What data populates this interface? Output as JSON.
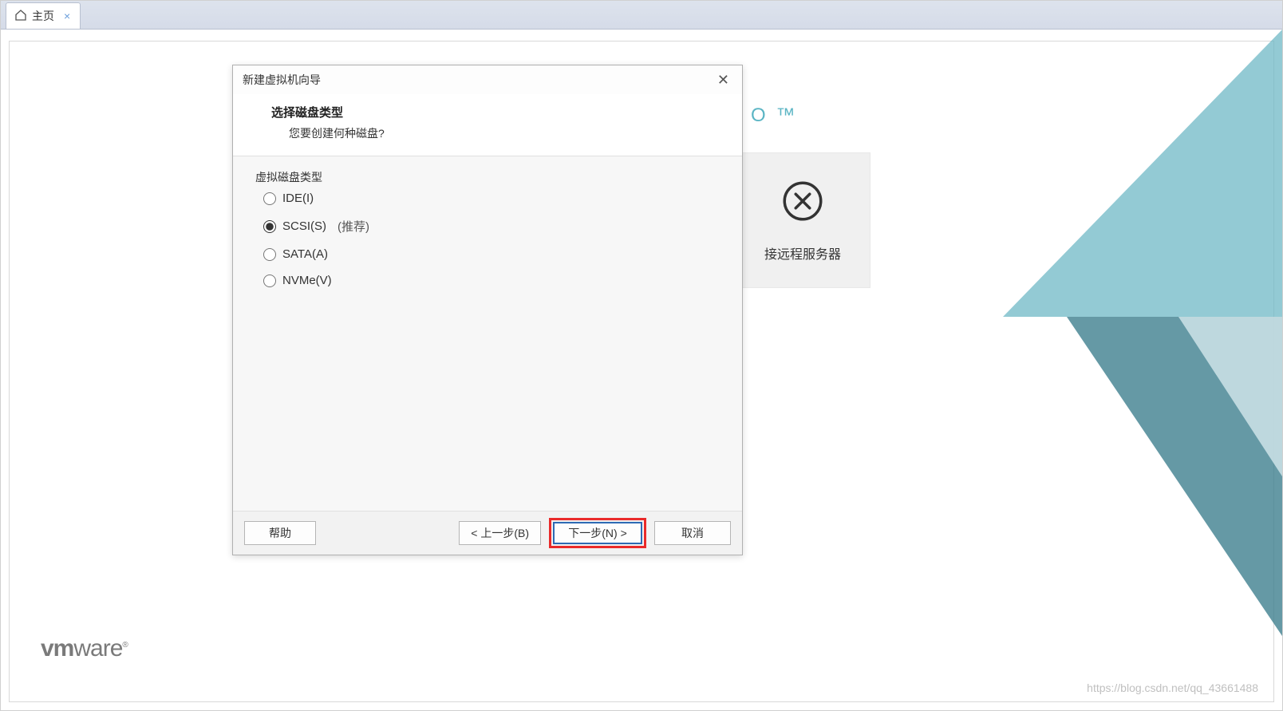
{
  "tab": {
    "label": "主页"
  },
  "background": {
    "tile_label": "接远程服务器",
    "trademark_suffix": "O ™",
    "vmware_logo_prefix": "vm",
    "vmware_logo_suffix": "ware",
    "vmware_logo_reg": "®"
  },
  "dialog": {
    "title": "新建虚拟机向导",
    "heading": "选择磁盘类型",
    "subheading": "您要创建何种磁盘?",
    "group_label": "虚拟磁盘类型",
    "options": [
      {
        "label": "IDE(I)",
        "selected": false,
        "hint": ""
      },
      {
        "label": "SCSI(S)",
        "selected": true,
        "hint": "(推荐)"
      },
      {
        "label": "SATA(A)",
        "selected": false,
        "hint": ""
      },
      {
        "label": "NVMe(V)",
        "selected": false,
        "hint": ""
      }
    ],
    "buttons": {
      "help": "帮助",
      "back": "< 上一步(B)",
      "next": "下一步(N) >",
      "cancel": "取消"
    }
  },
  "watermark": "https://blog.csdn.net/qq_43661488"
}
